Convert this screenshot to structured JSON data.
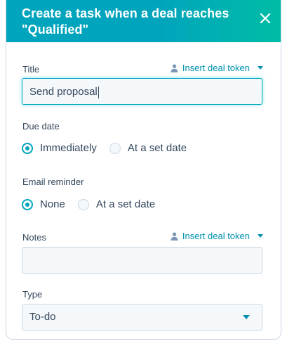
{
  "header": {
    "title": "Create a task when a deal reaches \"Qualified\"",
    "close_icon": "close-icon"
  },
  "title_field": {
    "label": "Title",
    "token_link": "Insert deal token",
    "value": "Send proposal"
  },
  "due_date": {
    "label": "Due date",
    "options": [
      "Immediately",
      "At a set date"
    ],
    "selected": "Immediately"
  },
  "email_reminder": {
    "label": "Email reminder",
    "options": [
      "None",
      "At a set date"
    ],
    "selected": "None"
  },
  "notes": {
    "label": "Notes",
    "token_link": "Insert deal token",
    "value": ""
  },
  "type_field": {
    "label": "Type",
    "value": "To-do"
  },
  "colors": {
    "accent": "#00a4bd",
    "link": "#0091ae",
    "text": "#33475b"
  }
}
